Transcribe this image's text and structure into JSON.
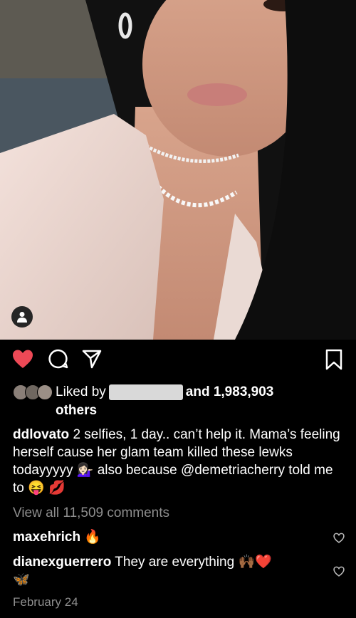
{
  "post": {
    "likes": {
      "prefix": "Liked by",
      "and_count": "and 1,983,903",
      "others": "others"
    },
    "caption": {
      "username": "ddlovato",
      "text": "2 selfies, 1 day.. can’t help it. Mama’s feeling herself cause her glam team killed these lewks todayyyyy 💁🏻‍♀️ also because @demetriacherry told me to 😝 💋"
    },
    "view_all_comments": "View all 11,509 comments",
    "comments": [
      {
        "username": "maxehrich",
        "text": "🔥"
      },
      {
        "username": "dianexguerrero",
        "text": "They are everything 🙌🏾❤️",
        "continued": "🦋"
      }
    ],
    "date": "February 24"
  },
  "colors": {
    "like_red": "#ed4956",
    "muted": "#8e8e8e",
    "background": "#000000"
  }
}
